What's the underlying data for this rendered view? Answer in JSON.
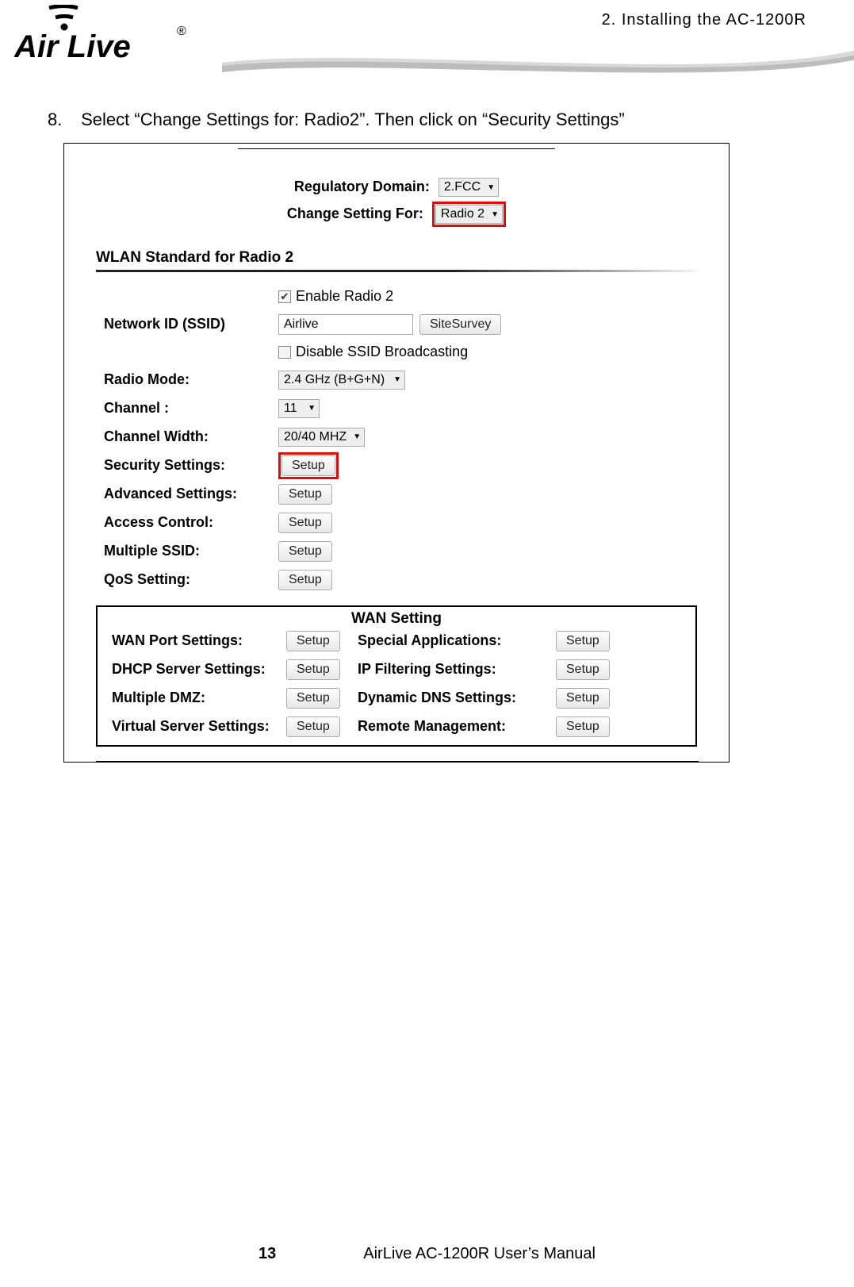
{
  "header": {
    "chapter": "2. Installing the AC-1200R",
    "logo_text": "Air Live"
  },
  "instruction": {
    "number": "8.",
    "text": "Select “Change Settings for: Radio2”.    Then click on “Security Settings”"
  },
  "config": {
    "regulatory_label": "Regulatory Domain:",
    "regulatory_value": "2.FCC",
    "change_for_label": "Change Setting For:",
    "change_for_value": "Radio 2",
    "wlan_section_title": "WLAN Standard for Radio 2",
    "enable_radio_label": "Enable Radio 2",
    "ssid_label": "Network ID (SSID)",
    "ssid_value": "Airlive",
    "sitesurvey_btn": "SiteSurvey",
    "disable_broadcast_label": "Disable SSID Broadcasting",
    "rows": [
      {
        "label": "Radio Mode:",
        "type": "select",
        "value": "2.4 GHz (B+G+N)"
      },
      {
        "label": "Channel :",
        "type": "select",
        "value": "11"
      },
      {
        "label": "Channel Width:",
        "type": "select",
        "value": "20/40 MHZ"
      },
      {
        "label": "Security Settings:",
        "type": "setup",
        "highlight": true
      },
      {
        "label": "Advanced Settings:",
        "type": "setup"
      },
      {
        "label": "Access Control:",
        "type": "setup"
      },
      {
        "label": "Multiple SSID:",
        "type": "setup"
      },
      {
        "label": "QoS Setting:",
        "type": "setup"
      }
    ],
    "setup_btn": "Setup"
  },
  "wan": {
    "title": "WAN Setting",
    "items": [
      {
        "left_label": "WAN Port Settings:",
        "right_label": "Special Applications:"
      },
      {
        "left_label": "DHCP Server Settings:",
        "right_label": "IP Filtering Settings:"
      },
      {
        "left_label": "Multiple DMZ:",
        "right_label": "Dynamic DNS Settings:"
      },
      {
        "left_label": "Virtual Server Settings:",
        "right_label": "Remote Management:"
      }
    ],
    "setup_btn": "Setup"
  },
  "footer": {
    "page": "13",
    "manual": "AirLive AC-1200R User’s Manual"
  }
}
